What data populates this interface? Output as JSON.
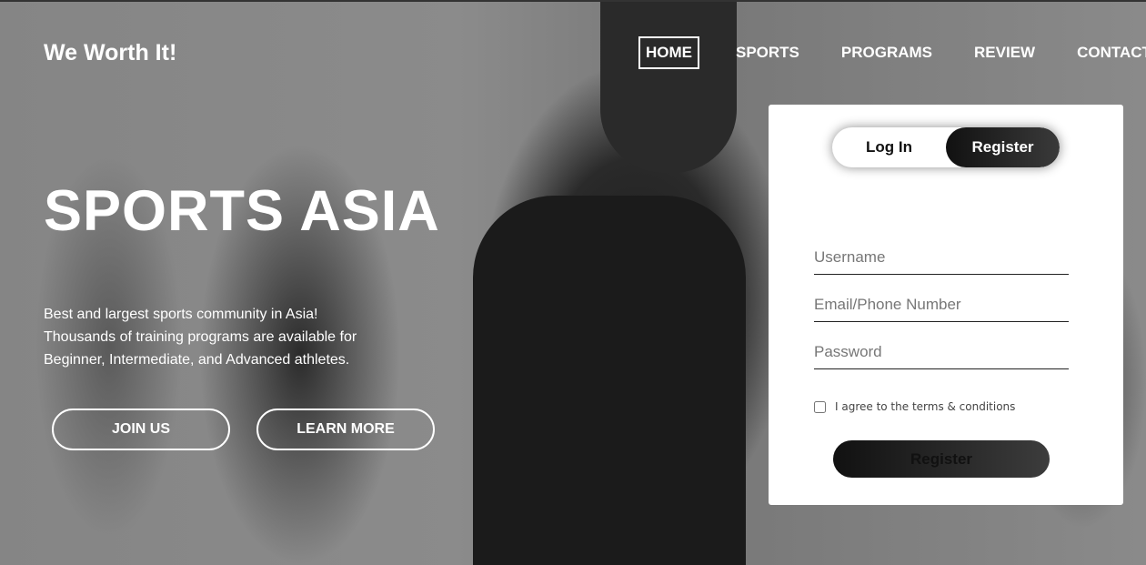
{
  "brand": {
    "name": "We Worth It!"
  },
  "nav": {
    "items": [
      {
        "label": "HOME",
        "active": true
      },
      {
        "label": "SPORTS",
        "active": false
      },
      {
        "label": "PROGRAMS",
        "active": false
      },
      {
        "label": "REVIEW",
        "active": false
      },
      {
        "label": "CONTACT US",
        "active": false
      }
    ]
  },
  "hero": {
    "title": "SPORTS ASIA",
    "description_lines": [
      "Best and largest sports community in Asia!",
      "Thousands of training programs are available for",
      "Beginner, Intermediate, and Advanced athletes."
    ],
    "join_label": "JOIN US",
    "learn_label": "LEARN MORE"
  },
  "auth": {
    "toggle": {
      "login_label": "Log In",
      "register_label": "Register",
      "active": "register"
    },
    "fields": {
      "username": {
        "placeholder": "Username",
        "value": ""
      },
      "email": {
        "placeholder": "Email/Phone Number",
        "value": ""
      },
      "password": {
        "placeholder": "Password",
        "value": ""
      }
    },
    "terms_label": "I agree to the terms & conditions",
    "terms_checked": false,
    "submit_label": "Register"
  },
  "colors": {
    "card_bg": "#ffffff",
    "button_dark": "#1a1a1a",
    "accent": "#ffffff"
  }
}
